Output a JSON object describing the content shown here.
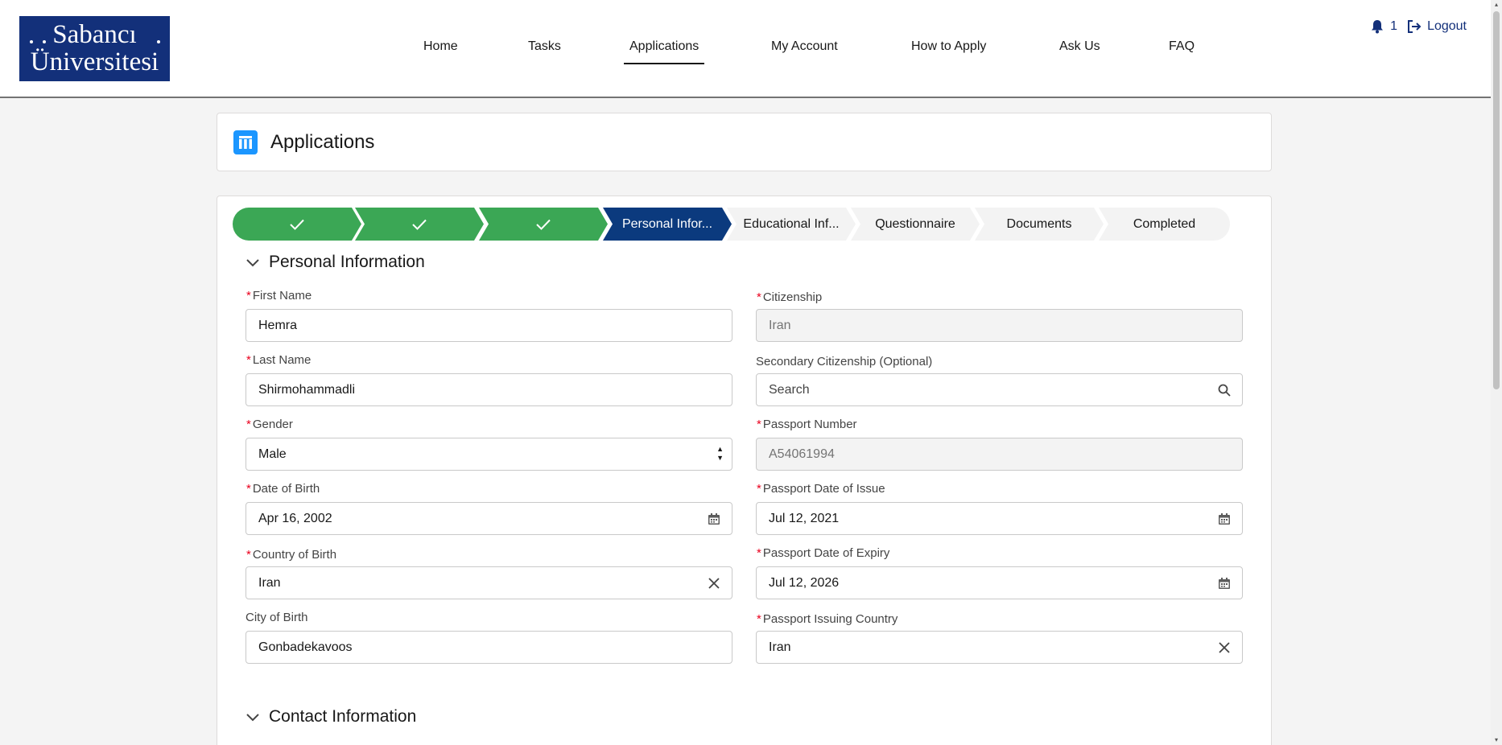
{
  "logo": {
    "line1": "Sabancı",
    "line2": "Üniversitesi"
  },
  "nav": [
    {
      "label": "Home"
    },
    {
      "label": "Tasks"
    },
    {
      "label": "Applications"
    },
    {
      "label": "My Account"
    },
    {
      "label": "How to Apply"
    },
    {
      "label": "Ask Us"
    },
    {
      "label": "FAQ"
    }
  ],
  "header_right": {
    "notification_count": "1",
    "logout_label": "Logout"
  },
  "page_title": "Applications",
  "path": {
    "steps": [
      {
        "label": "",
        "state": "complete"
      },
      {
        "label": "",
        "state": "complete"
      },
      {
        "label": "",
        "state": "complete"
      },
      {
        "label": "Personal Infor...",
        "state": "current"
      },
      {
        "label": "Educational Inf...",
        "state": "incomplete"
      },
      {
        "label": "Questionnaire",
        "state": "incomplete"
      },
      {
        "label": "Documents",
        "state": "incomplete"
      },
      {
        "label": "Completed",
        "state": "incomplete"
      }
    ],
    "colors": {
      "complete": "#3ba755",
      "current": "#0b3a7e",
      "incomplete": "#f3f3f3"
    }
  },
  "sections": {
    "personal": "Personal Information",
    "contact": "Contact Information"
  },
  "fields": {
    "first_name": {
      "label": "First Name",
      "value": "Hemra"
    },
    "last_name": {
      "label": "Last Name",
      "value": "Shirmohammadli"
    },
    "gender": {
      "label": "Gender",
      "value": "Male"
    },
    "dob": {
      "label": "Date of Birth",
      "value": "Apr 16, 2002"
    },
    "country_of_birth": {
      "label": "Country of Birth",
      "value": "Iran"
    },
    "city_of_birth": {
      "label": "City of Birth",
      "value": "Gonbadekavoos"
    },
    "citizenship": {
      "label": "Citizenship",
      "value": "Iran"
    },
    "secondary_citizenship": {
      "label": "Secondary Citizenship (Optional)",
      "placeholder": "Search"
    },
    "passport_number": {
      "label": "Passport Number",
      "value": "A54061994"
    },
    "passport_issue": {
      "label": "Passport Date of Issue",
      "value": "Jul 12, 2021"
    },
    "passport_expiry": {
      "label": "Passport Date of Expiry",
      "value": "Jul 12, 2026"
    },
    "passport_country": {
      "label": "Passport Issuing Country",
      "value": "Iran"
    }
  }
}
